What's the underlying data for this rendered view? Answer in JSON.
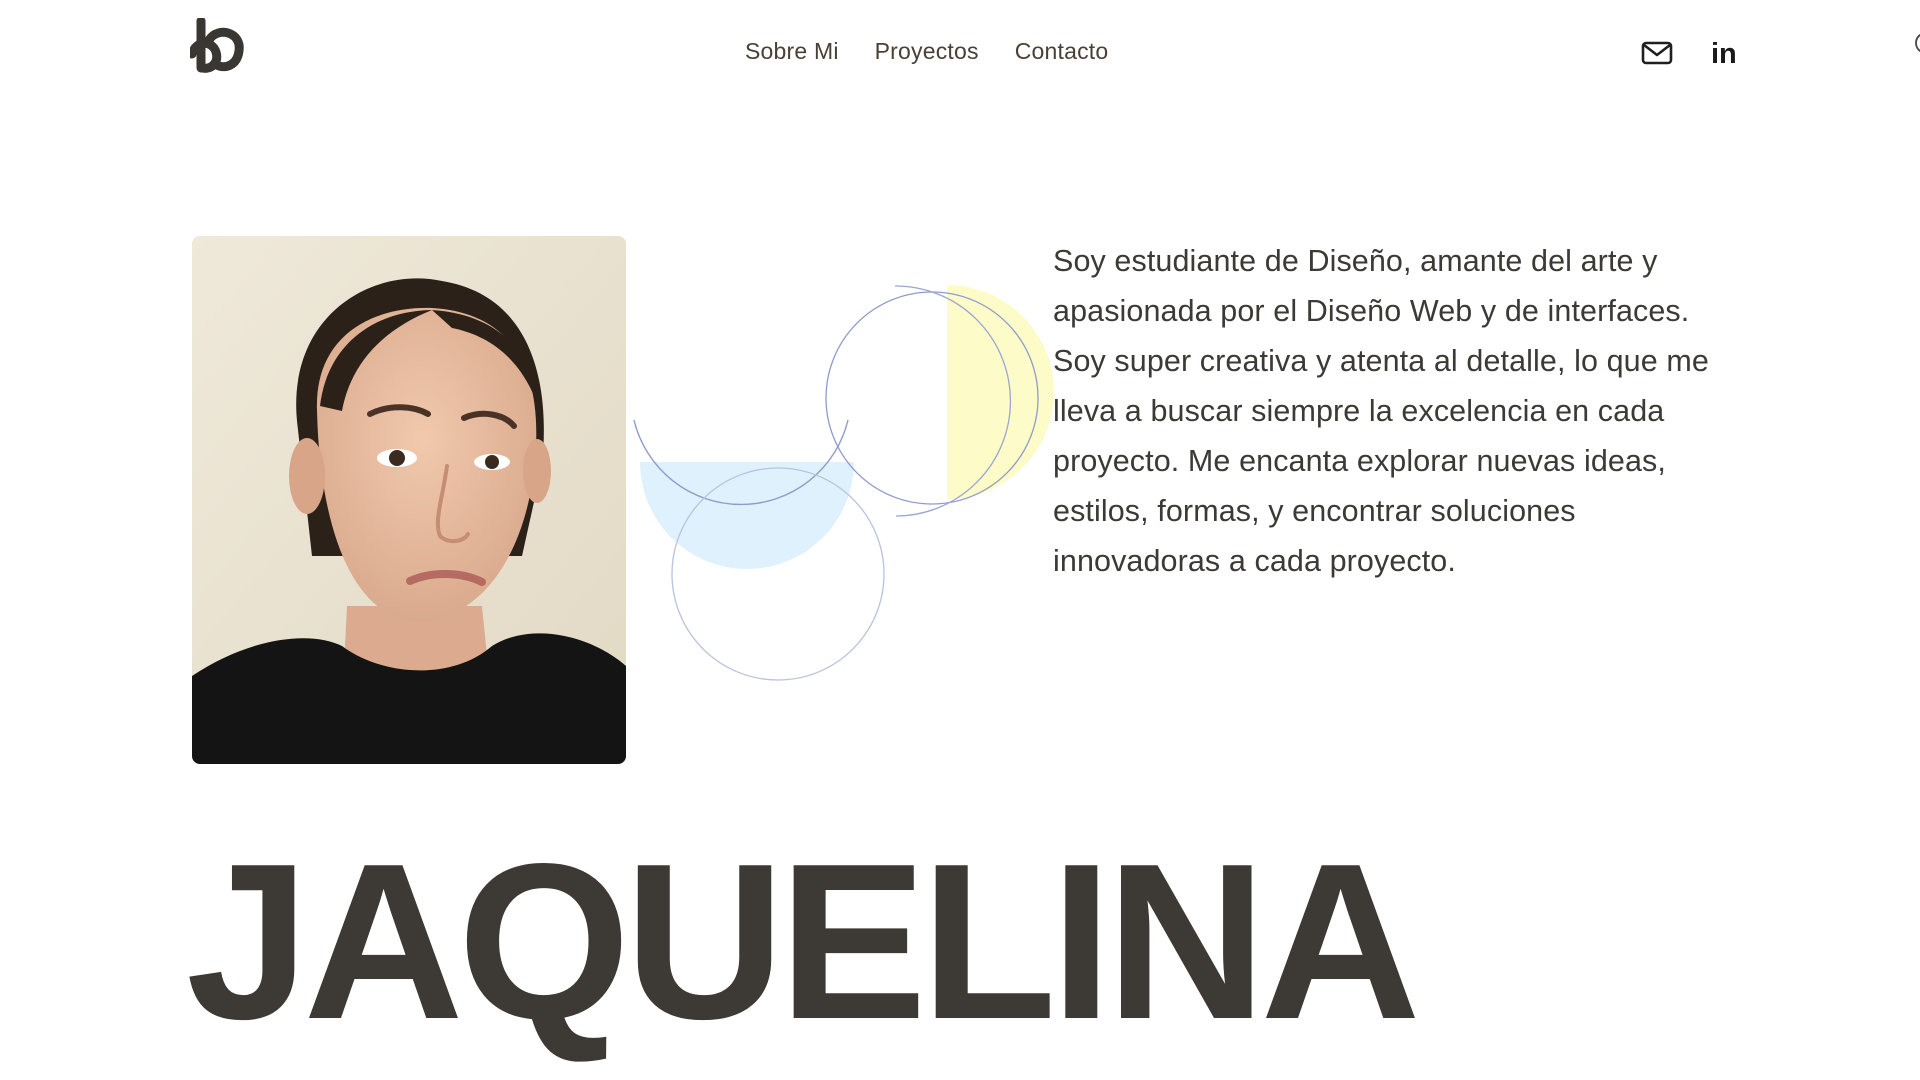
{
  "brand": {
    "logo_icon": "jd-monogram-logo-icon"
  },
  "nav": {
    "items": [
      {
        "label": "Sobre Mi"
      },
      {
        "label": "Proyectos"
      },
      {
        "label": "Contacto"
      }
    ]
  },
  "social": {
    "email_icon": "envelope-icon",
    "linkedin_icon": "linkedin-icon",
    "linkedin_text": "in"
  },
  "hero": {
    "bio": "Soy estudiante de Diseño, amante del arte y apasionada por el Diseño Web y de interfaces. Soy super creativa y atenta al detalle, lo que me lleva a buscar siempre la excelencia en cada proyecto. Me encanta explorar nuevas ideas, estilos, formas, y encontrar soluciones innovadoras a cada proyecto.",
    "name": "JAQUELINA"
  },
  "colors": {
    "text": "#3d3a35",
    "nav_text": "#4a4035",
    "accent_blue": "#dff1fd",
    "accent_yellow": "#fdfcc8",
    "outline_blue": "#7f8fc8",
    "background": "#ffffff"
  }
}
